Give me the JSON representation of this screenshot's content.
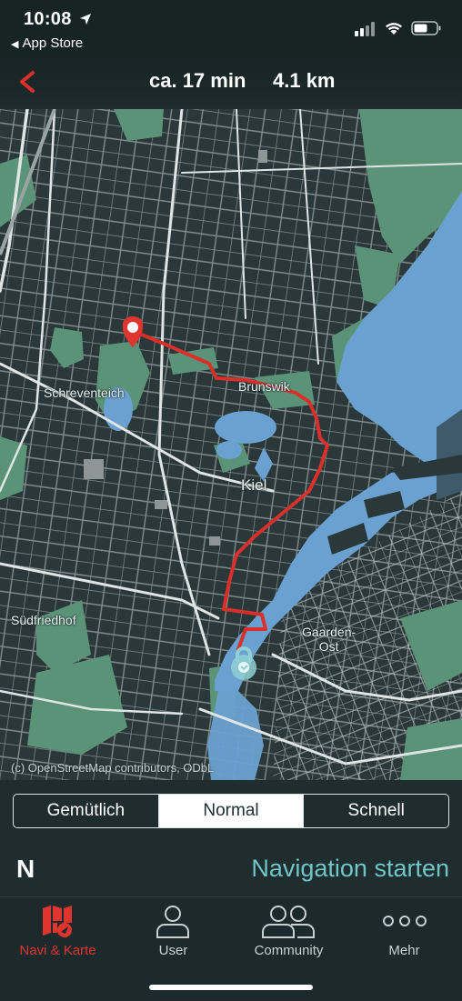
{
  "status": {
    "time": "10:08",
    "back_app": "App Store"
  },
  "header": {
    "duration": "ca. 17 min",
    "distance": "4.1 km"
  },
  "map": {
    "labels": {
      "schreventeich": "Schreventeich",
      "brunswik": "Brunswik",
      "kiel": "Kiel",
      "suedfriedhof": "Südfriedhof",
      "gaarden": "Gaarden-\nOst"
    },
    "attribution": "(c) OpenStreetMap contributors, ODbL",
    "colors": {
      "land": "#2a3839",
      "water": "#6aa1d1",
      "park": "#5a9378",
      "road": "#d8dede",
      "route": "#d9302c"
    }
  },
  "route_modes": {
    "options": [
      "Gemütlich",
      "Normal",
      "Schnell"
    ],
    "selected": "Normal"
  },
  "compass": "N",
  "start_navigation": "Navigation starten",
  "tabs": [
    {
      "label": "Navi & Karte",
      "icon": "map-icon",
      "active": true
    },
    {
      "label": "User",
      "icon": "user-icon",
      "active": false
    },
    {
      "label": "Community",
      "icon": "community-icon",
      "active": false
    },
    {
      "label": "Mehr",
      "icon": "more-icon",
      "active": false
    }
  ]
}
